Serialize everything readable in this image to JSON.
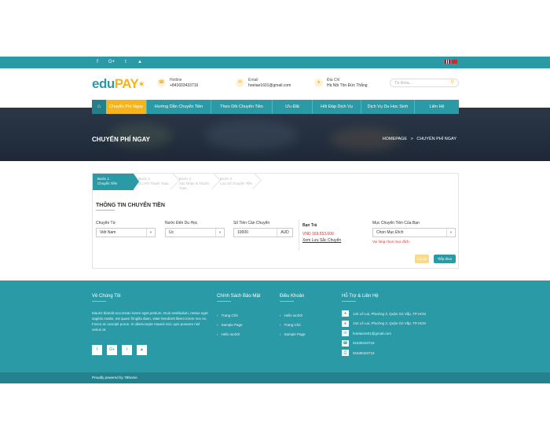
{
  "topbar": {
    "social": [
      "f",
      "G+",
      "t",
      "yt"
    ],
    "social_names": [
      "facebook",
      "google-plus",
      "twitter",
      "youtube"
    ]
  },
  "header": {
    "logo_edu": "edu",
    "logo_pay": "PAY",
    "hotline": {
      "label": "Hotline",
      "value": "+841603433716"
    },
    "email": {
      "label": "Email",
      "value": "hoetae1601@gmail.com"
    },
    "address": {
      "label": "Địa Chỉ",
      "value": "Hà Nội Tôn Đức Thắng"
    },
    "search_placeholder": "Từ khóa..."
  },
  "nav": {
    "items": [
      "Chuyển Phí Ngay",
      "Hướng Dẫn Chuyển Tiền",
      "Theo Dõi Chuyển Tiền",
      "Ưu Đãi",
      "Hỏi Đáp Dịch Vụ",
      "Dịch Vụ Du Học Sinh",
      "Liên Hệ"
    ],
    "active_index": 0
  },
  "hero": {
    "title": "CHUYỂN PHÍ NGAY",
    "breadcrumb_home": "HOMEPAGE",
    "breadcrumb_sep": ">",
    "breadcrumb_current": "CHUYỂN PHÍ NGAY"
  },
  "steps": [
    {
      "title": "Bước 1",
      "sub": "Chuyển Tiền"
    },
    {
      "title": "Bước 2",
      "sub": "Du Hồi Thanh Toán"
    },
    {
      "title": "Bước 3",
      "sub": "Xác Nhận & Thanh Toán"
    },
    {
      "title": "Bước 4",
      "sub": "Lưu Số Chuyển Tiền"
    }
  ],
  "form": {
    "section_title": "THÔNG TIN CHUYỂN TIỀN",
    "from_label": "Chuyển Từ",
    "from_value": "Việt Nam",
    "to_label": "Nước Đến Du Học",
    "to_value": "Úc",
    "amount_label": "Số Tiền Cần Chuyển",
    "amount_value": "10000",
    "currency": "AUD",
    "pay_label": "Bạn Trả",
    "pay_value": "VND 169.553.600",
    "pay_link": "Xem Lưu Sắc Chuyển",
    "purpose_label": "Mục Chuyển Tiền Của Bạn",
    "purpose_value": "Chọn Mục Đích",
    "purpose_error": "Vui lòng chọn mục đích.",
    "back_label": "Lùi lại",
    "next_label": "Tiếp theo"
  },
  "footer": {
    "about_title": "Về Chúng Tôi",
    "about_text": "Mauris blandit accumsan lorem eget pretium. Duis vestibulum, metus eget sagittis mattis, est quam fringilla diam, vitae hendrerit libero lorem nec ex. Fusce ac suscipit purus. In ullamcorper mauris nisl, quis posuere nisl varius at.",
    "policy_title": "Chính Sách Bảo Mật",
    "policy_items": [
      "Trang Chủ",
      "Sample Page",
      "Hello world!"
    ],
    "terms_title": "Điều Khoản",
    "terms_items": [
      "Hello world!",
      "Trang Chủ",
      "Sample Page"
    ],
    "support_title": "Hỗ Trợ & Liên Hệ",
    "support_items": [
      "134 Lê Lai, Phường 3, Quận Gò Vấp, TP.HCM",
      "134 Lê Lai, Phường 3, Quận Gò Vấp, TP.HCM",
      "hoetae1601@gmail.com",
      "01639433716",
      "01639433716"
    ],
    "copyright": "Proudly powered by 7Bhome"
  }
}
